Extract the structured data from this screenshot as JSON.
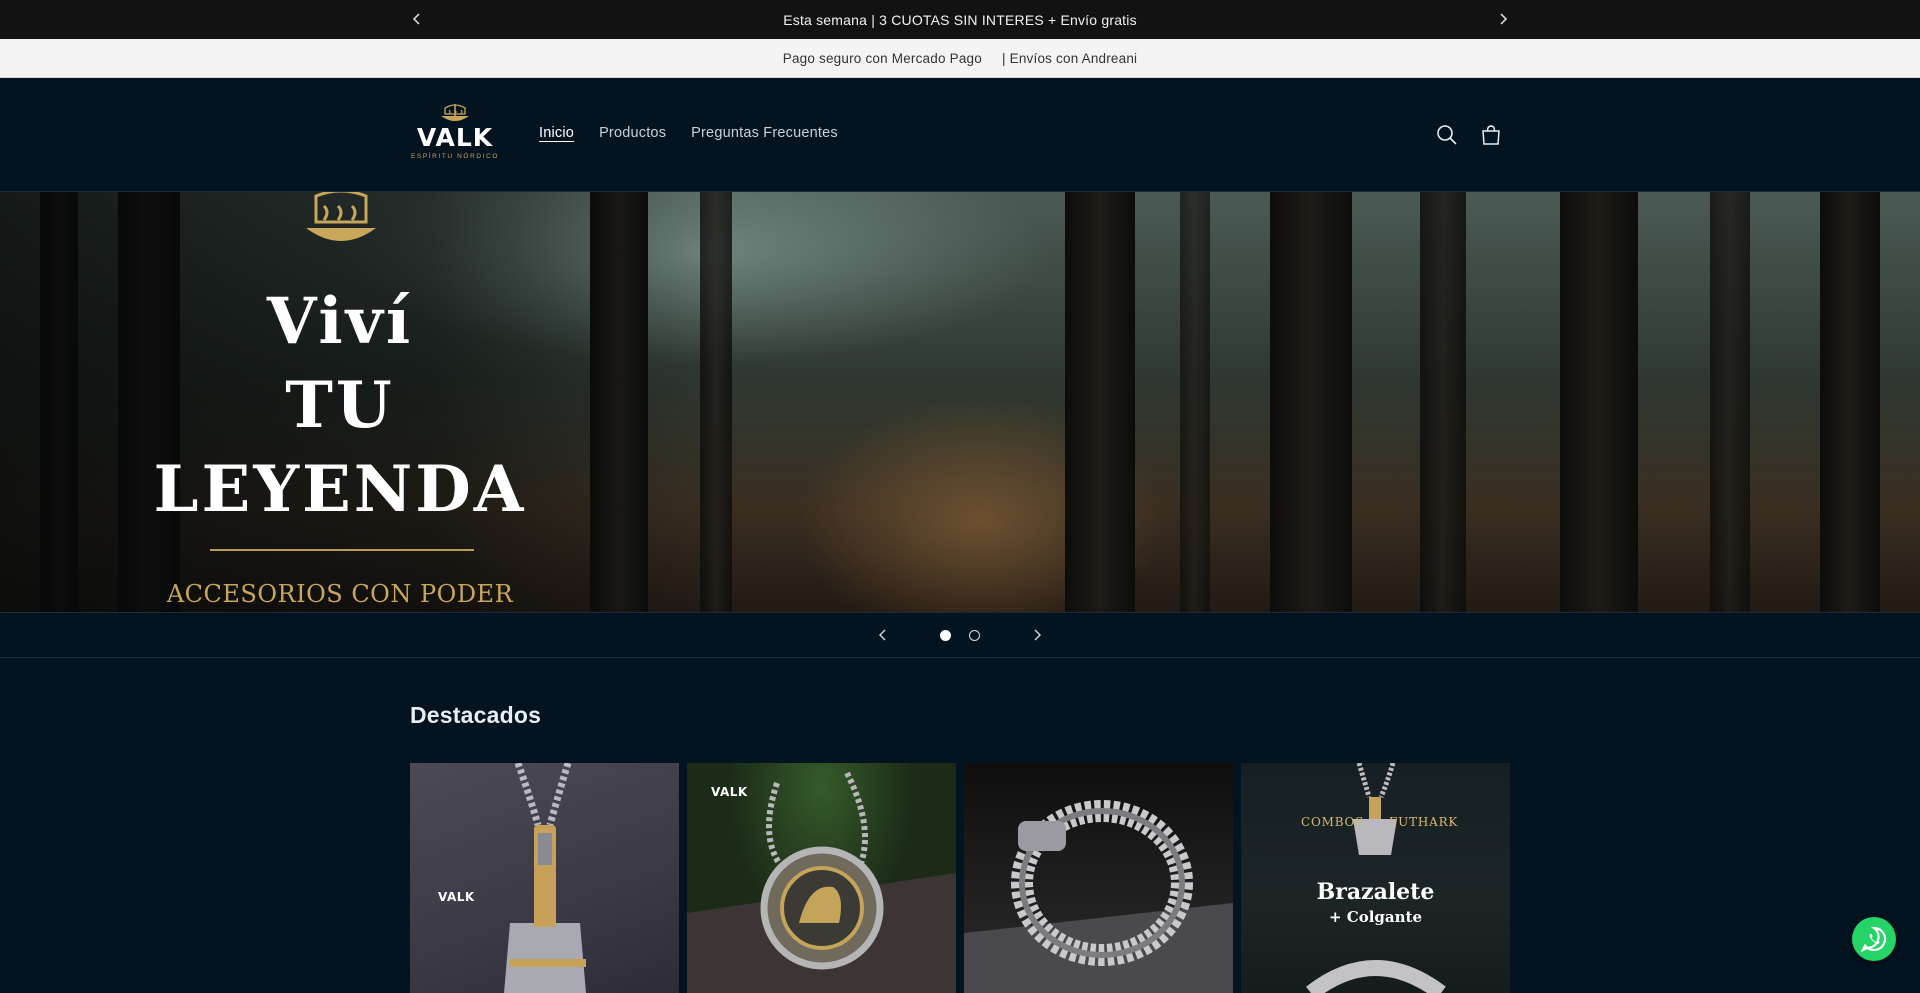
{
  "announcement": {
    "text": "Esta semana | 3 CUOTAS SIN INTERES + Envío gratis",
    "prev_icon": "chevron-left-icon",
    "next_icon": "chevron-right-icon"
  },
  "subbar": {
    "left": "Pago seguro con Mercado Pago",
    "right": "| Envíos con Andreani"
  },
  "header": {
    "logo_word": "VALK",
    "logo_tagline": "ESPÍRITU NÓRDICO",
    "nav": [
      "Inicio",
      "Productos",
      "Preguntas Frecuentes"
    ],
    "active_nav": "Inicio",
    "icons": [
      "search-icon",
      "cart-icon"
    ]
  },
  "hero": {
    "title_line1": "Viví",
    "title_line2": "TU",
    "title_line3": "LEYENDA",
    "subtitle": "ACCESORIOS CON PODER",
    "accent_color": "#c8a65a"
  },
  "slider": {
    "slide_count": 2,
    "active_slide": 1
  },
  "featured": {
    "title": "Destacados",
    "cards": [
      {
        "brand": "VALK"
      },
      {
        "brand": "VALK"
      },
      {},
      {
        "left_text": "COMBOS",
        "right_text": "FUTHARK",
        "big1": "Brazalete",
        "big2": "+ Colgante"
      }
    ]
  },
  "whatsapp": {
    "icon": "whatsapp-icon",
    "color": "#25d366"
  }
}
